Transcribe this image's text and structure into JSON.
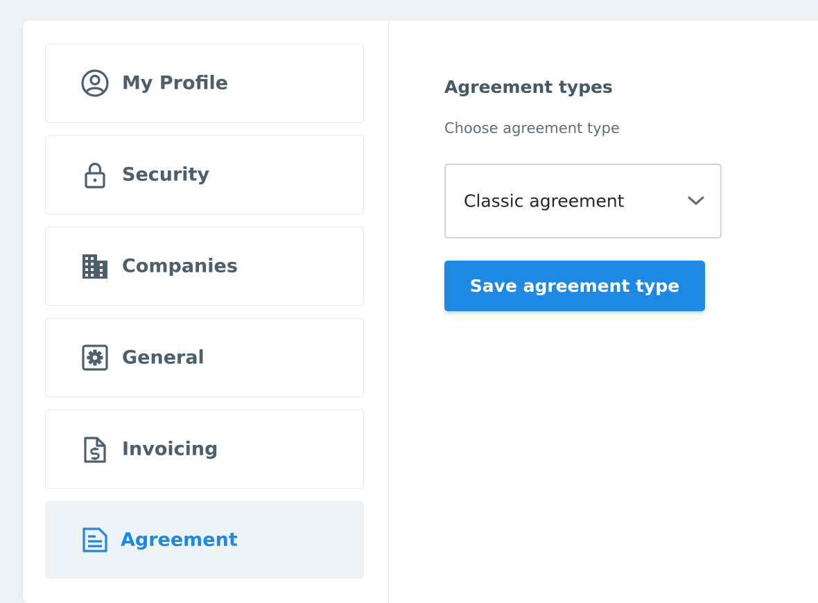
{
  "sidebar": {
    "items": [
      {
        "label": "My Profile",
        "icon": "user-circle-icon"
      },
      {
        "label": "Security",
        "icon": "lock-icon"
      },
      {
        "label": "Companies",
        "icon": "building-icon"
      },
      {
        "label": "General",
        "icon": "gear-square-icon"
      },
      {
        "label": "Invoicing",
        "icon": "invoice-dollar-icon"
      },
      {
        "label": "Agreement",
        "icon": "document-icon",
        "active": true
      }
    ]
  },
  "content": {
    "title": "Agreement types",
    "subtitle": "Choose agreement type",
    "select": {
      "value": "Classic agreement"
    },
    "save_label": "Save agreement type"
  },
  "colors": {
    "accent": "#1e88e5",
    "text": "#4d5f6c",
    "background": "#ebf1f5",
    "active_bg": "#eef3f7"
  }
}
